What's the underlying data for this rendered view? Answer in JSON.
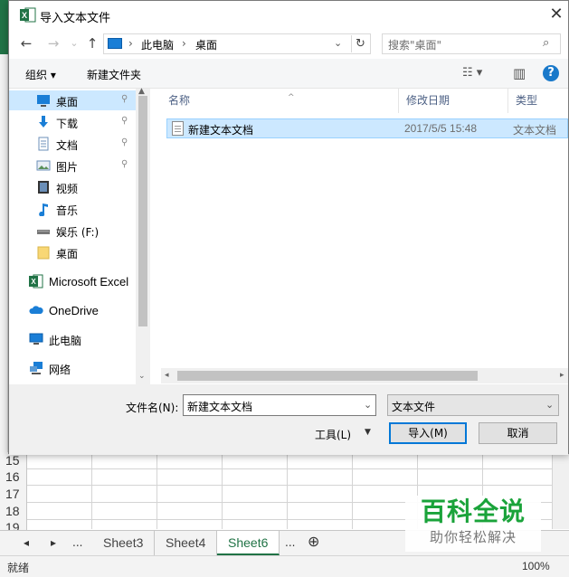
{
  "dialog": {
    "title": "导入文本文件",
    "close_glyph": "✕"
  },
  "nav": {
    "back": "←",
    "forward": "→",
    "recent": "⌄",
    "up": "↑",
    "address_segments": [
      "此电脑",
      "桌面"
    ],
    "address_separator": "›",
    "dropdown": "⌄",
    "refresh": "↻",
    "search_placeholder": "搜索\"桌面\"",
    "search_glyph": "⌕"
  },
  "toolbar": {
    "organize": "组织 ▾",
    "new_folder": "新建文件夹",
    "view_glyph": "☷ ▾",
    "preview_glyph": "▥",
    "help": "?"
  },
  "sidebar": {
    "items": [
      {
        "label": "桌面",
        "pinned": true,
        "selected": true,
        "icon": "desktop-icon"
      },
      {
        "label": "下载",
        "pinned": true,
        "icon": "download-icon"
      },
      {
        "label": "文档",
        "pinned": true,
        "icon": "document-icon"
      },
      {
        "label": "图片",
        "pinned": true,
        "icon": "pictures-icon"
      },
      {
        "label": "视频",
        "icon": "video-icon"
      },
      {
        "label": "音乐",
        "icon": "music-icon"
      },
      {
        "label": "娱乐 (F:)",
        "icon": "drive-icon"
      },
      {
        "label": "桌面",
        "icon": "folder-icon"
      },
      {
        "label": "Microsoft Excel",
        "icon": "excel-icon"
      },
      {
        "label": "OneDrive",
        "icon": "onedrive-icon"
      },
      {
        "label": "此电脑",
        "icon": "computer-icon"
      },
      {
        "label": "网络",
        "icon": "network-icon"
      }
    ],
    "pin_glyph": "📌"
  },
  "filelist": {
    "columns": [
      "名称",
      "修改日期",
      "类型"
    ],
    "sort_glyph": "^",
    "rows": [
      {
        "name": "新建文本文档",
        "date": "2017/5/5 15:48",
        "type": "文本文档"
      }
    ]
  },
  "footer": {
    "filename_label": "文件名(N):",
    "filename_value": "新建文本文档",
    "filetype_value": "文本文件",
    "tools_label": "工具(L)",
    "tools_dd": "▼",
    "import_button": "导入(M)",
    "cancel_button": "取消"
  },
  "excel": {
    "row_numbers": [
      "15",
      "16",
      "17",
      "18",
      "19"
    ],
    "sheet_nav": [
      "◂",
      "▸",
      "..."
    ],
    "sheets": [
      "Sheet3",
      "Sheet4",
      "Sheet6"
    ],
    "active_sheet": "Sheet6",
    "more": "...",
    "add_sheet": "⊕",
    "status": "就绪",
    "zoom": "100%",
    "accent": "#217346"
  },
  "watermark": {
    "main": "百科全说",
    "sub": "助你轻松解决"
  }
}
